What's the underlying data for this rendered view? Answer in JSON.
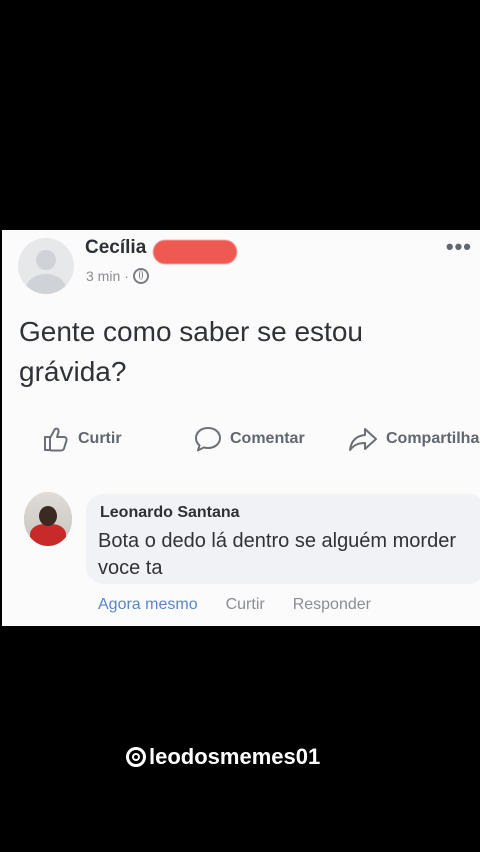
{
  "post": {
    "author_name": "Cecília",
    "time": "3 min",
    "separator": "·",
    "text": "Gente como saber se estou grávida?",
    "more_menu": "•••"
  },
  "actions": {
    "like_label": "Curtir",
    "comment_label": "Comentar",
    "share_label": "Compartilhar"
  },
  "comment": {
    "author": "Leonardo Santana",
    "text": "Bota o dedo lá dentro se alguém morder voce ta",
    "time": "Agora mesmo",
    "like_label": "Curtir",
    "reply_label": "Responder"
  },
  "watermark": {
    "handle": "leodosmemes01",
    "icon": "threads-icon"
  },
  "colors": {
    "background": "#000000",
    "card": "#fbfbfb",
    "redaction": "#ee5a52",
    "link_blue": "#5b85c9"
  }
}
